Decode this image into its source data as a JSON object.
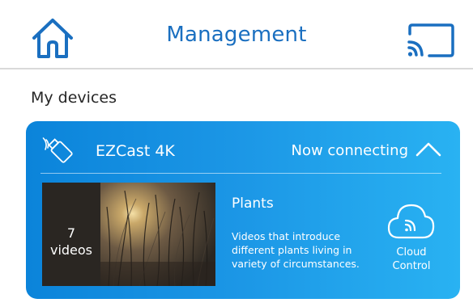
{
  "header": {
    "title": "Management",
    "home_icon": "home-icon",
    "cast_icon": "screen-cast-icon"
  },
  "section": {
    "label": "My devices"
  },
  "device": {
    "icon": "dongle-wireless-icon",
    "name": "EZCast 4K",
    "status": "Now connecting",
    "expand_icon": "chevron-up-icon",
    "video": {
      "count_number": "7",
      "count_unit": "videos",
      "title": "Plants",
      "description": "Videos that introduce different plants living in variety of circumstances."
    },
    "cloud_control": {
      "icon": "cloud-cast-icon",
      "label_line1": "Cloud",
      "label_line2": "Control"
    }
  },
  "colors": {
    "accent": "#1a6fc0",
    "card_start": "#0b84da",
    "card_end": "#29b2f2"
  }
}
